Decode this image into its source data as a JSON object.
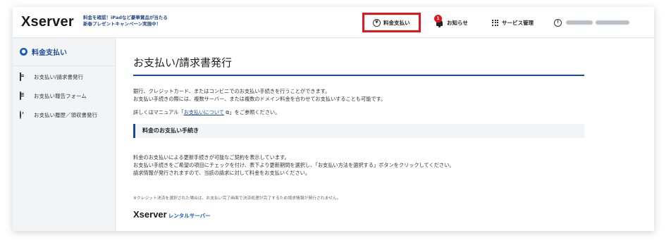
{
  "header": {
    "logo": "Xserver",
    "promo_line1": "料金を確認！iPadなど豪華賞品が当たる",
    "promo_line2": "新春プレゼントキャンペーン実施中！",
    "nav": {
      "payment": "料金支払い",
      "news": "お知らせ",
      "news_badge": "1",
      "services": "サービス管理"
    }
  },
  "sidebar": {
    "title": "料金支払い",
    "items": [
      {
        "label": "お支払い/請求書発行",
        "icon": "document-icon"
      },
      {
        "label": "お支払い報告フォーム",
        "icon": "form-icon"
      },
      {
        "label": "お支払い履歴／領収書発行",
        "icon": "history-icon"
      }
    ]
  },
  "main": {
    "title": "お支払い/請求書発行",
    "intro_1": "銀行、クレジットカード、またはコンビニでのお支払い手続きを行うことができます。",
    "intro_2": "お支払い手続きの際には、複数サーバー、または複数のドメイン料金を合わせてお支払いすることも可能です。",
    "manual_pre": "詳しくはマニュアル「",
    "manual_link": "お支払いについて",
    "manual_post": "」をご参照ください。",
    "section_title": "料金のお支払い手続き",
    "section_1": "料金のお支払いによる更新手続きが可能なご契約を表示しています。",
    "section_2": "お支払い手続きをご希望の項目にチェックを付け、表下より更新期間を選択し、「お支払い方法を選択する」ボタンをクリックしてください。",
    "section_3": "請求情報が発行されますので、当該の請求に対して料金をお支払いください。",
    "note": "※クレジット決済を選択された場合は、お支払い完了画面で決済処理が完了するため請求情報が発行されません。",
    "brand_main": "Xserver",
    "brand_sub": "レンタルサーバー"
  }
}
